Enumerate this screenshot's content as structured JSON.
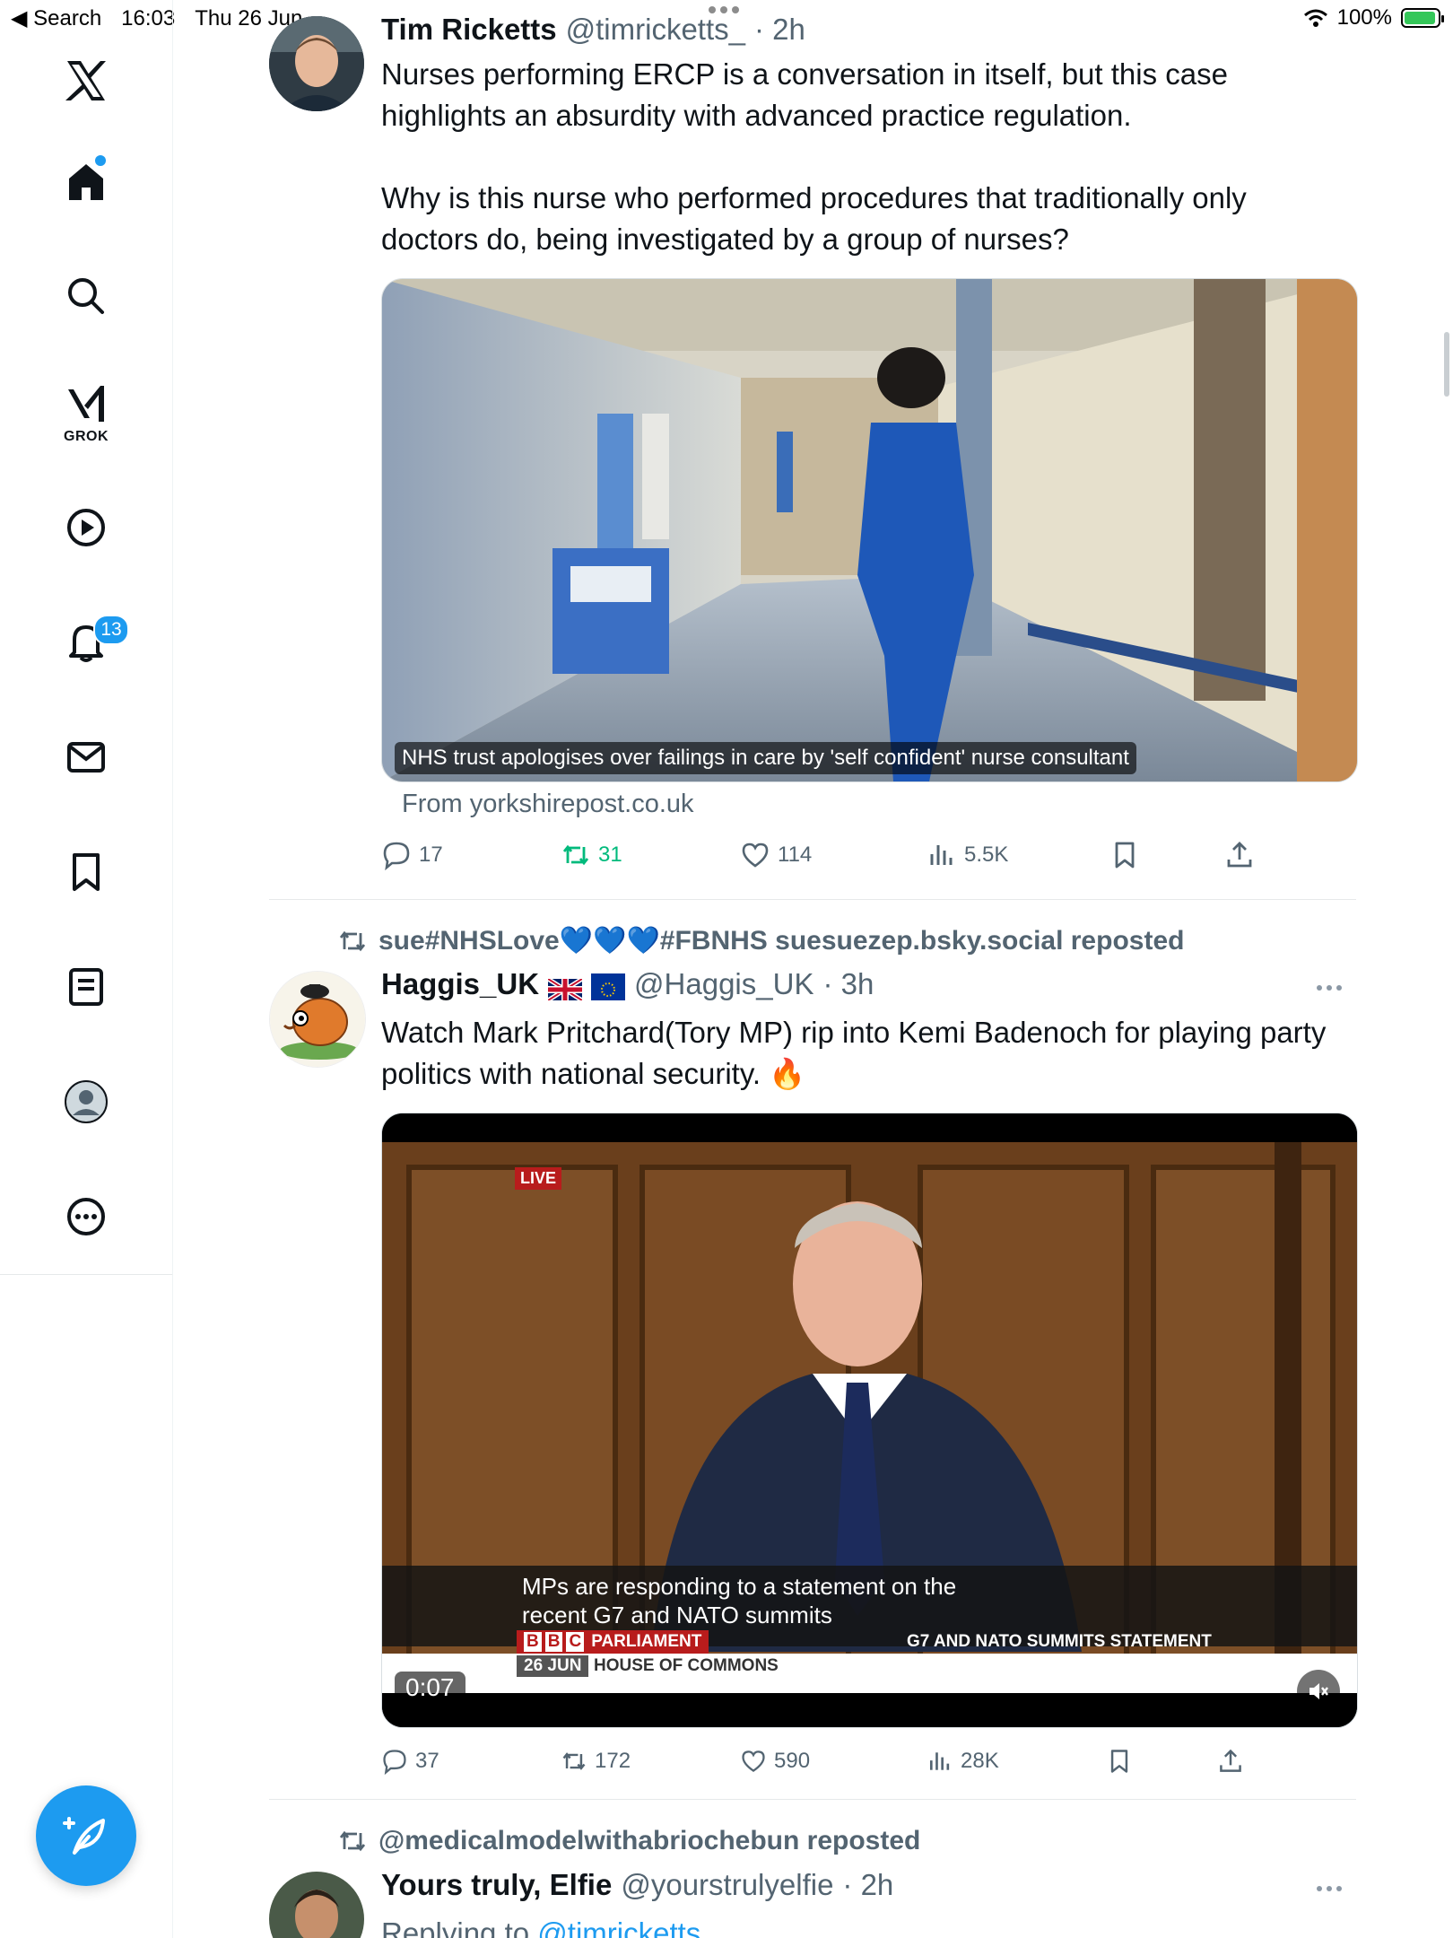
{
  "status_bar": {
    "back_label": "◀ Search",
    "time": "16:03",
    "date": "Thu 26 Jun",
    "battery": "100%"
  },
  "sidebar": {
    "grok_label": "GROK",
    "notifications_badge": "13",
    "items": [
      "x-logo-icon",
      "home-icon",
      "search-icon",
      "grok-icon",
      "video-icon",
      "notifications-icon",
      "messages-icon",
      "bookmarks-icon",
      "lists-icon",
      "profile-icon",
      "more-icon"
    ]
  },
  "tweets": [
    {
      "name": "Tim Ricketts",
      "handle": "@timricketts_",
      "time": "· 2h",
      "text_p1": "Nurses performing ERCP is a conversation in itself, but this case highlights an absurdity with advanced practice regulation.",
      "text_p2": "Why is this nurse who performed procedures that traditionally only doctors do, being investigated by a group of nurses?",
      "card_caption": "NHS trust apologises over failings in care by 'self confident' nurse consultant",
      "card_source": "From yorkshirepost.co.uk",
      "replies": "17",
      "reposts": "31",
      "likes": "114",
      "views": "5.5K"
    },
    {
      "repost_by": "sue#NHSLove💙💙💙#FBNHS suesuezep.bsky.social reposted",
      "name": "Haggis_UK",
      "handle": "@Haggis_UK",
      "time": "· 3h",
      "text": "Watch Mark Pritchard(Tory MP) rip into Kemi Badenoch for playing party politics with national security. 🔥",
      "video": {
        "live_tag": "LIVE",
        "subtitle_line1": "MPs are responding to a statement on the",
        "subtitle_line2": "recent G7 and NATO summits",
        "bbc_letters": [
          "B",
          "B",
          "C"
        ],
        "channel": "PARLIAMENT",
        "strap": "G7 AND NATO SUMMITS STATEMENT",
        "date": "26 JUN",
        "location": "HOUSE OF COMMONS",
        "duration": "0:07"
      },
      "replies": "37",
      "reposts": "172",
      "likes": "590",
      "views": "28K"
    },
    {
      "repost_by": "@medicalmodelwithabriochebun reposted",
      "name": "Yours truly, Elfie",
      "handle": "@yourstrulyelfie",
      "time": "· 2h",
      "replying_prefix": "Replying to",
      "replying_handle": "@timricketts"
    }
  ],
  "colors": {
    "accent": "#1d9bf0",
    "repost_active": "#00ba7c",
    "muted": "#536471"
  }
}
